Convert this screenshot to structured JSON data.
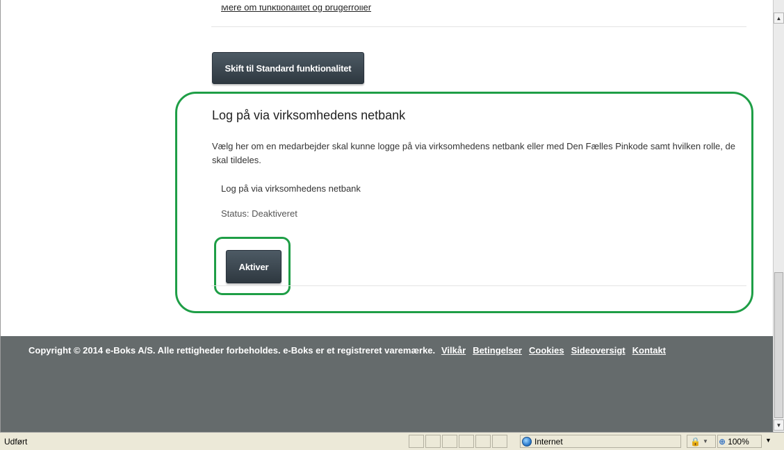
{
  "top_link": "Mere om funktionalitet og brugerroller",
  "switch_button": "Skift til Standard funktionalitet",
  "netbank_section": {
    "title": "Log på via virksomhedens netbank",
    "description": "Vælg her om en medarbejder skal kunne logge på via virksomhedens netbank eller med Den Fælles Pinkode samt hvilken rolle, de skal tildeles.",
    "option_label": "Log på via virksomhedens netbank",
    "status": "Status: Deaktiveret",
    "activate_button": "Aktiver"
  },
  "footer": {
    "copyright": "Copyright © 2014 e-Boks A/S. Alle rettigheder forbeholdes. e-Boks er et registreret varemærke.",
    "links": [
      "Vilkår",
      "Betingelser",
      "Cookies",
      "Sideoversigt",
      "Kontakt"
    ]
  },
  "statusbar": {
    "status_text": "Udført",
    "zone": "Internet",
    "zone_icon": "globe-icon",
    "protected_mode_icon": "lock-icon",
    "zoom_label": "100%",
    "zoom_icon": "magnifier-icon"
  },
  "colors": {
    "highlight_frame": "#1e9e46",
    "footer_bg": "#656b6c",
    "button_dark": "#3a464f"
  }
}
